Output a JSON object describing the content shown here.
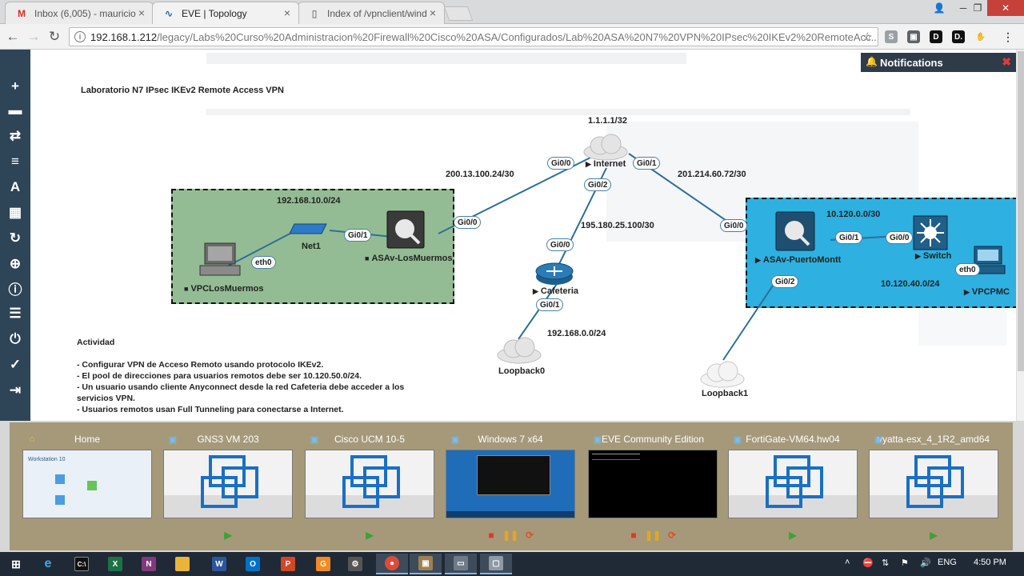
{
  "browser": {
    "tabs": [
      {
        "title": "Inbox (6,005) - mauricio",
        "icon": "gmail-icon"
      },
      {
        "title": "EVE | Topology",
        "icon": "eve-icon"
      },
      {
        "title": "Index of /vpnclient/wind",
        "icon": "document-icon"
      }
    ],
    "active_tab": 1,
    "url_host": "192.168.1.212",
    "url_path": "/legacy/Labs%20Curso%20Administracion%20Firewall%20Cisco%20ASA/Configurados/Lab%20ASA%20N7%20VPN%20IPsec%20IKEv2%20RemoteAcc..."
  },
  "sidebar": {
    "icons": [
      "add-icon",
      "node-stack-icon",
      "connections-icon",
      "list-icon",
      "text-icon",
      "grid-icon",
      "refresh-icon",
      "zoom-icon",
      "info-icon",
      "notes-icon",
      "power-icon",
      "check-icon",
      "logout-icon"
    ]
  },
  "notifications": {
    "label": "Notifications"
  },
  "topology": {
    "title": "Laboratorio N7 IPsec IKEv2 Remote Access VPN",
    "networks": {
      "lan_losmuermos": "192.168.10.0/24",
      "wan_losmuermos": "200.13.100.24/30",
      "internet_loop": "1.1.1.1/32",
      "wan_puertomontt": "201.214.60.72/30",
      "wan_cafeteria": "195.180.25.100/30",
      "lan_cafeteria": "192.168.0.0/24",
      "pm_transit": "10.120.0.0/30",
      "pm_lan": "10.120.40.0/24"
    },
    "nodes": {
      "vpc_lm": "VPCLosMuermos",
      "net1": "Net1",
      "asa_lm": "ASAv-LosMuermos",
      "internet": "Internet",
      "cafeteria": "Cafeteria",
      "asa_pm": "ASAv-PuertoMontt",
      "switch": "Switch",
      "vpc_pm": "VPCPMC",
      "loopback0": "Loopback0",
      "loopback1": "Loopback1"
    },
    "interfaces": {
      "vpc_lm_eth0": "eth0",
      "asa_lm_gi01": "Gi0/1",
      "asa_lm_gi00": "Gi0/0",
      "inet_gi00": "Gi0/0",
      "inet_gi01": "Gi0/1",
      "inet_gi02": "Gi0/2",
      "caf_gi00": "Gi0/0",
      "caf_gi01": "Gi0/1",
      "asa_pm_gi00": "Gi0/0",
      "asa_pm_gi01": "Gi0/1",
      "asa_pm_gi02": "Gi0/2",
      "sw_gi00": "Gi0/0",
      "vpc_pm_eth0": "eth0"
    },
    "activity": {
      "heading": "Actividad",
      "items": [
        "- Configurar VPN de Acceso Remoto usando protocolo IKEv2.",
        "- El pool de direcciones para usuarios remotos debe ser 10.120.50.0/24.",
        "- Un usuario usando cliente Anyconnect desde la red Cafeteria debe acceder a los servicios VPN.",
        "- Usuarios remotos usan Full Tunneling para conectarse a Internet."
      ]
    }
  },
  "vms": [
    {
      "name": "Home",
      "icon": "home-icon",
      "thumb": "home",
      "thumb_text": "Workstation 10",
      "controls": []
    },
    {
      "name": "GNS3 VM 203",
      "icon": "vm-icon",
      "thumb": "vmware",
      "controls": [
        "play"
      ]
    },
    {
      "name": "Cisco UCM 10-5",
      "icon": "vm-icon",
      "thumb": "vmware",
      "controls": [
        "play"
      ]
    },
    {
      "name": "Windows 7 x64",
      "icon": "vm-icon",
      "thumb": "win7",
      "controls": [
        "stop",
        "pause",
        "restart"
      ]
    },
    {
      "name": "EVE Community Edition",
      "icon": "vm-icon",
      "thumb": "console",
      "controls": [
        "stop",
        "pause",
        "restart"
      ]
    },
    {
      "name": "FortiGate-VM64.hw04",
      "icon": "vm-icon",
      "thumb": "vmware",
      "controls": [
        "play"
      ]
    },
    {
      "name": "vyatta-esx_4_1R2_amd64",
      "icon": "vm-icon",
      "thumb": "vmware",
      "controls": [
        "play"
      ]
    }
  ],
  "taskbar": {
    "language": "ENG",
    "time": "4:50 PM"
  },
  "colors": {
    "eve_sidebar": "#2e4457",
    "green_network": "#94bc94",
    "blue_network": "#2eb0e0",
    "switcher_panel": "#a5997a",
    "taskbar": "#1f2a36"
  }
}
